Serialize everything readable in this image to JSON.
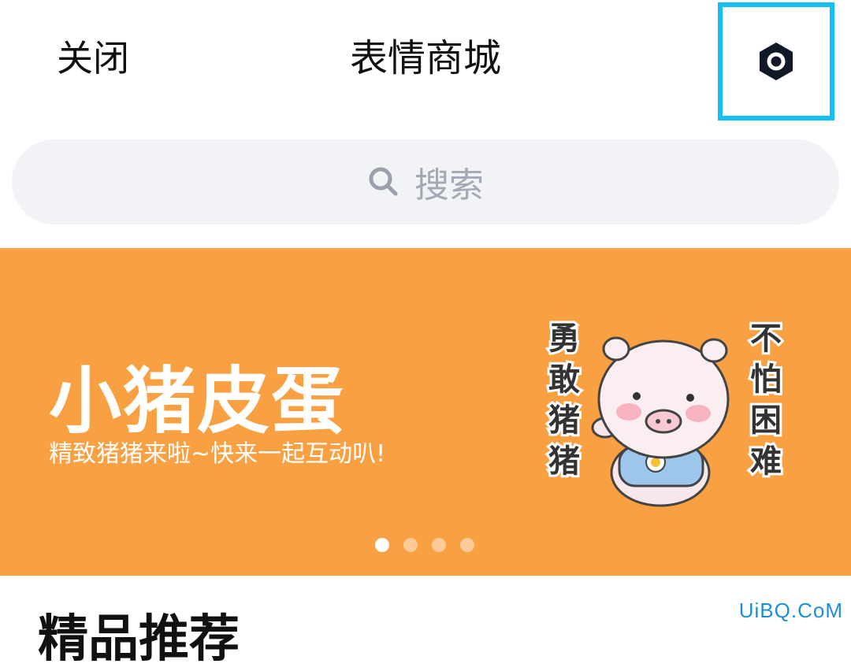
{
  "header": {
    "close_label": "关闭",
    "title": "表情商城",
    "settings_icon": "settings-hexagon-icon"
  },
  "search": {
    "placeholder": "搜索",
    "icon": "search-icon"
  },
  "banner": {
    "title": "小猪皮蛋",
    "subtitle": "精致猪猪来啦~快来一起互动叭!",
    "sticker_text_left": "勇敢猪猪",
    "sticker_text_right": "不怕困难",
    "background_color": "#f9a042",
    "page_indicator": {
      "total": 4,
      "active_index": 0
    }
  },
  "section": {
    "title": "精品推荐"
  },
  "watermark": "UiBQ.CoM",
  "colors": {
    "highlight_border": "#12c0f5",
    "search_bg": "#f2f3f7",
    "placeholder": "#a3a8b4"
  }
}
